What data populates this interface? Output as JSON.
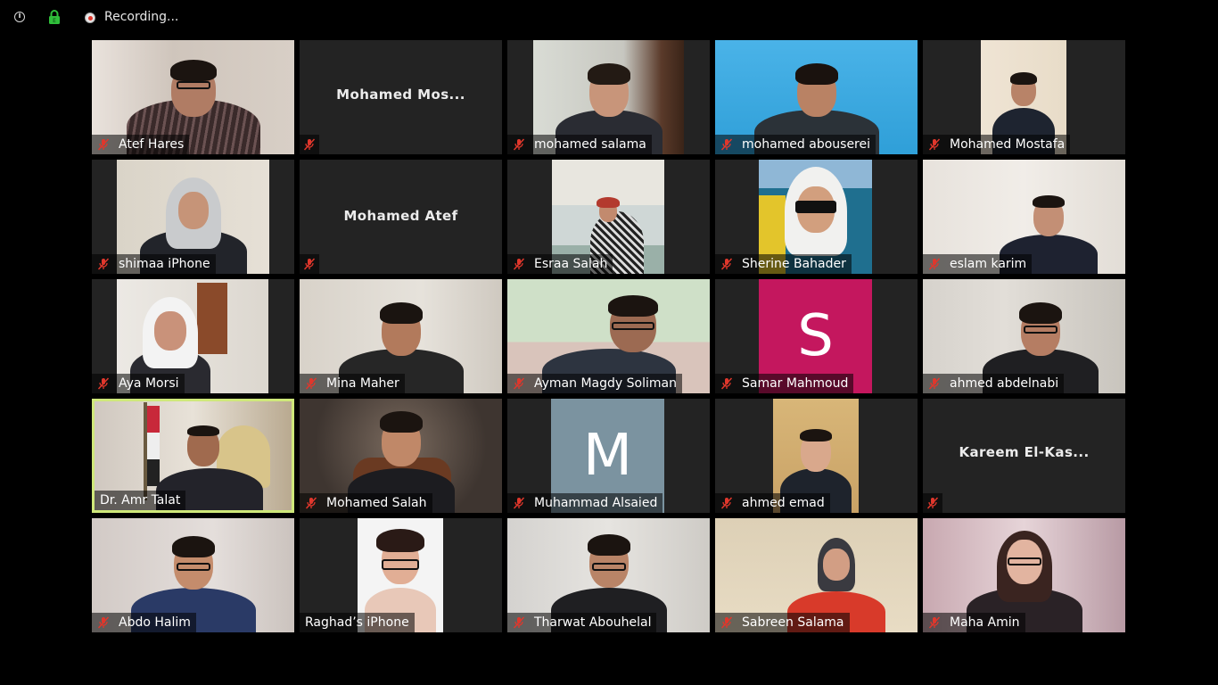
{
  "topbar": {
    "info_icon": "info-icon",
    "lock_icon": "green-lock-icon",
    "recording_label": "Recording..."
  },
  "colors": {
    "background": "#000000",
    "tile_background": "#232323",
    "active_speaker_border": "#cfe87a",
    "muted_icon": "#e0372c",
    "recording_dot": "#e0372c",
    "lock_green": "#2fbf3a",
    "samar_avatar": "#c4175e",
    "muhammad_avatar": "#7b93a0"
  },
  "participants": [
    {
      "name": "Atef Hares",
      "muted": true
    },
    {
      "name": "",
      "display_name": "Mohamed Mos...",
      "muted": true
    },
    {
      "name": "mohamed salama",
      "muted": true
    },
    {
      "name": "mohamed abouserei",
      "muted": true
    },
    {
      "name": "Mohamed Mostafa",
      "muted": true
    },
    {
      "name": "shimaa iPhone",
      "muted": true
    },
    {
      "name": "",
      "display_name": "Mohamed Atef",
      "muted": true
    },
    {
      "name": "Esraa Salah",
      "muted": true
    },
    {
      "name": "Sherine Bahader",
      "muted": true
    },
    {
      "name": "eslam karim",
      "muted": true
    },
    {
      "name": "Aya Morsi",
      "muted": true
    },
    {
      "name": "Mina Maher",
      "muted": true
    },
    {
      "name": "Ayman Magdy Soliman",
      "muted": true
    },
    {
      "name": "Samar Mahmoud",
      "muted": true,
      "avatar_letter": "S"
    },
    {
      "name": "ahmed abdelnabi",
      "muted": true
    },
    {
      "name": "Dr. Amr Talat",
      "muted": false,
      "active_speaker": true
    },
    {
      "name": "Mohamed Salah",
      "muted": true
    },
    {
      "name": "Muhammad Alsaied",
      "muted": true,
      "avatar_letter": "M"
    },
    {
      "name": "ahmed emad",
      "muted": true
    },
    {
      "name": "",
      "display_name": "Kareem El-Kas...",
      "muted": true
    },
    {
      "name": "Abdo Halim",
      "muted": true
    },
    {
      "name": "Raghad’s iPhone",
      "muted": false
    },
    {
      "name": "Tharwat Abouhelal",
      "muted": true
    },
    {
      "name": "Sabreen Salama",
      "muted": true
    },
    {
      "name": "Maha Amin",
      "muted": true
    }
  ]
}
